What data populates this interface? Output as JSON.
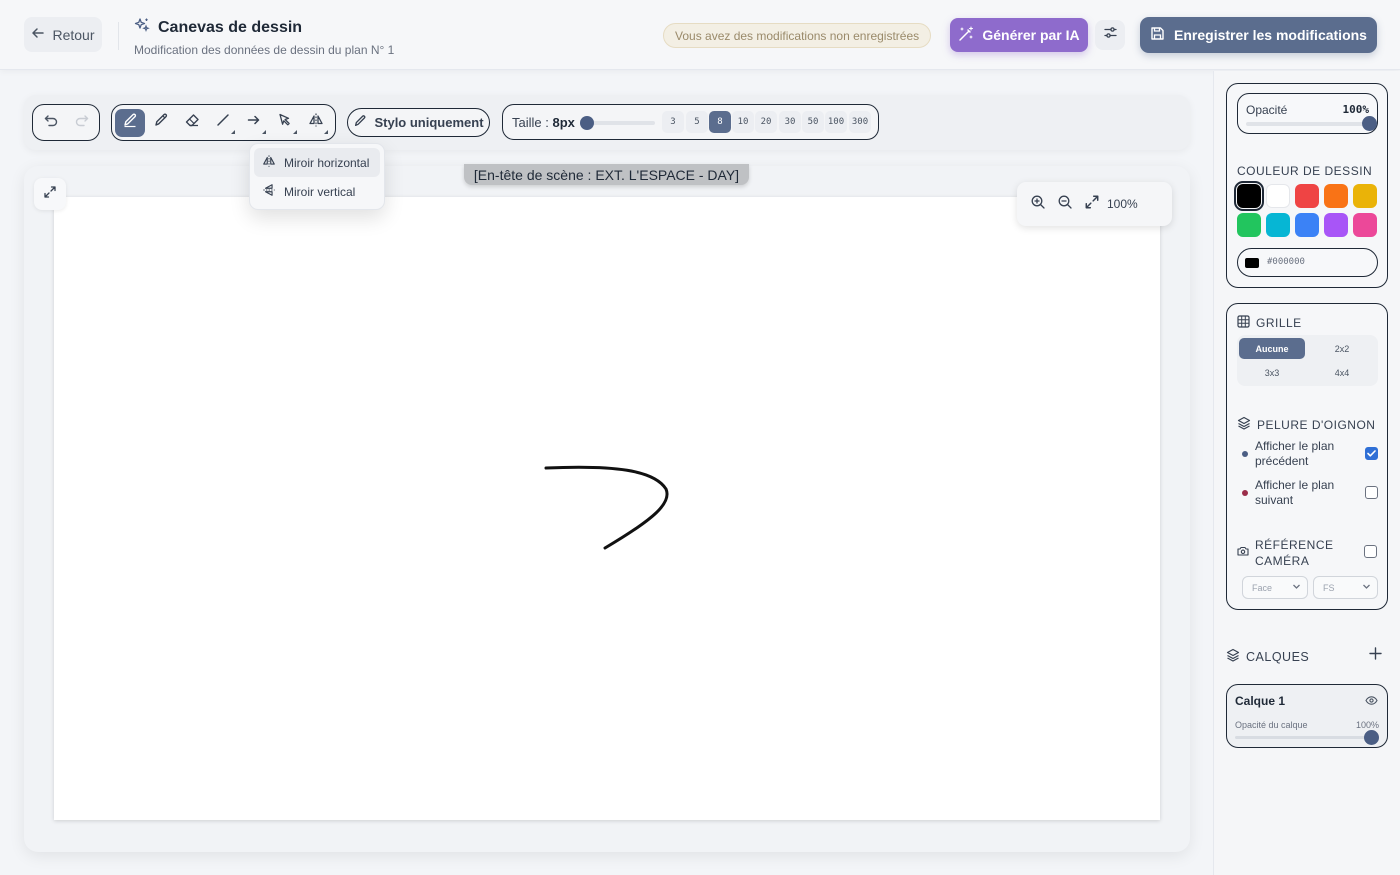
{
  "header": {
    "back_label": "Retour",
    "title": "Canevas de dessin",
    "subtitle": "Modification des données de dessin du plan N° 1",
    "unsaved": "Vous avez des modifications non enregistrées",
    "ai_label": "Générer par IA",
    "save_label": "Enregistrer les modifications"
  },
  "toolbar": {
    "pen_only": "Stylo uniquement",
    "size_label": "Taille : ",
    "size_value": "8px",
    "size_fraction": 0.0,
    "presets": [
      "3",
      "5",
      "8",
      "10",
      "20",
      "30",
      "50",
      "100",
      "300"
    ],
    "selected_preset": "8"
  },
  "mirror_menu": {
    "horizontal": "Miroir horizontal",
    "vertical": "Miroir vertical"
  },
  "canvas": {
    "scene_header": "[En-tête de scène : EXT. L'ESPACE - DAY]",
    "zoom": "100%"
  },
  "panel": {
    "opacity_label": "Opacité",
    "opacity_value": "100%",
    "color_title": "COULEUR DE DESSIN",
    "colors": [
      "#000000",
      "#ffffff",
      "#ef4444",
      "#f97316",
      "#eab308",
      "#22c55e",
      "#06b6d4",
      "#3b82f6",
      "#a855f7",
      "#ec4899"
    ],
    "hex_value": "#000000",
    "grid_title": "GRILLE",
    "grid_options": [
      "Aucune",
      "2x2",
      "3x3",
      "4x4"
    ],
    "onion_title": "PELURE D'OIGNON",
    "onion_prev": "Afficher le plan précédent",
    "onion_next": "Afficher le plan suivant",
    "prev_color": "#4b5e84",
    "next_color": "#9b2d4a",
    "camera_title": "RÉFÉRENCE CAMÉRA",
    "camera_angle": "Face",
    "camera_shot": "FS",
    "layers_title": "CALQUES",
    "layer_name": "Calque 1",
    "layer_opacity_label": "Opacité du calque",
    "layer_opacity_value": "100%"
  }
}
